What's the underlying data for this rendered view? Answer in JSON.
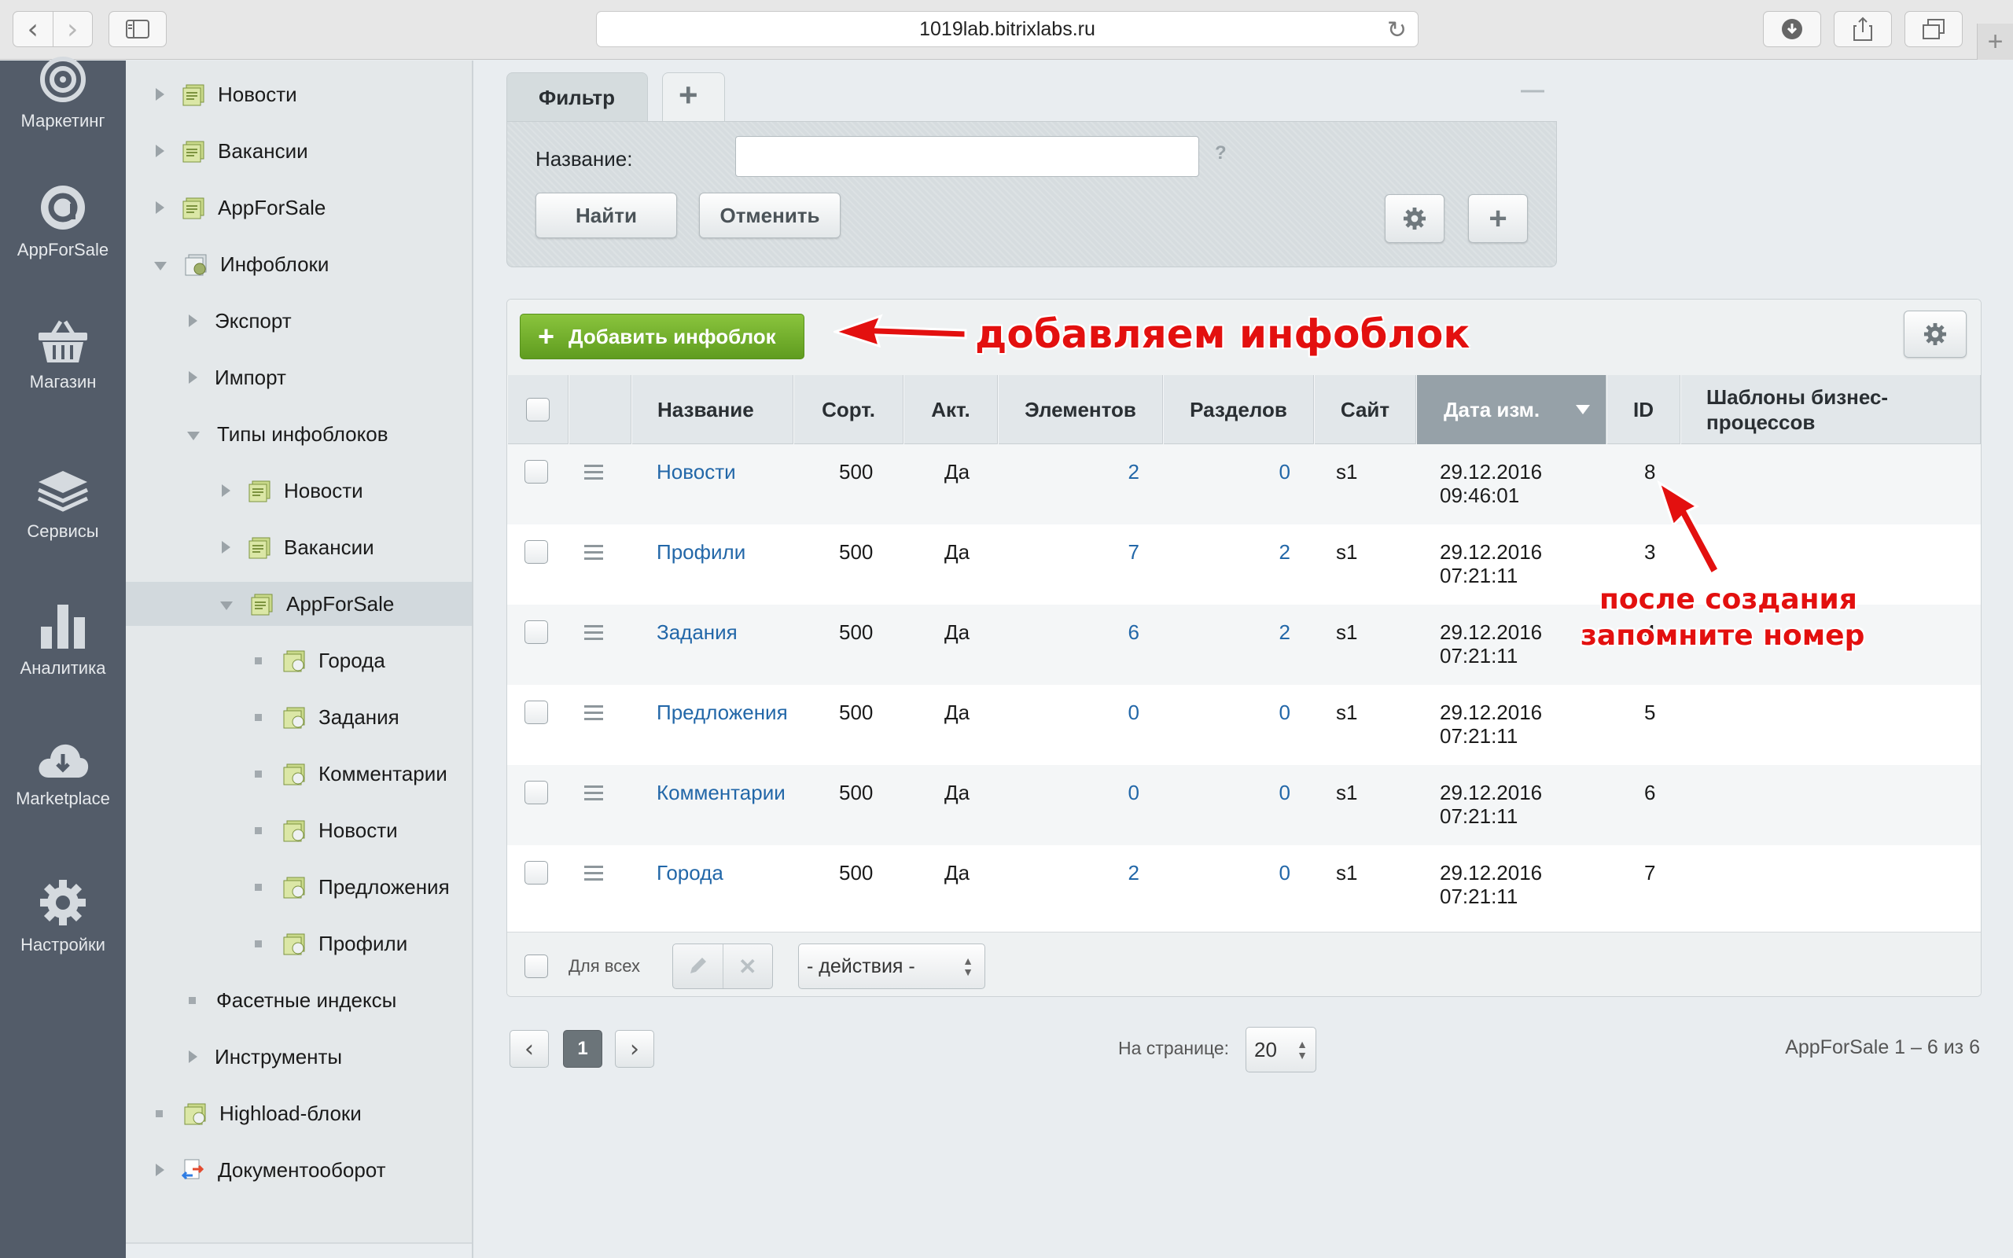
{
  "browser": {
    "url": "1019lab.bitrixlabs.ru",
    "back_glyph": "‹",
    "forward_glyph": "›",
    "newtab_glyph": "+"
  },
  "leftnav": {
    "items": [
      {
        "label": "Маркетинг",
        "icon": "target-icon"
      },
      {
        "label": "AppForSale",
        "icon": "appforsale-icon"
      },
      {
        "label": "Магазин",
        "icon": "basket-icon"
      },
      {
        "label": "Сервисы",
        "icon": "layers-icon"
      },
      {
        "label": "Аналитика",
        "icon": "bar-chart-icon"
      },
      {
        "label": "Marketplace",
        "icon": "cloud-download-icon"
      },
      {
        "label": "Настройки",
        "icon": "gear-icon"
      }
    ]
  },
  "tree": {
    "items": [
      {
        "label": "Новости"
      },
      {
        "label": "Вакансии"
      },
      {
        "label": "AppForSale"
      },
      {
        "label": "Инфоблоки"
      },
      {
        "label": "Экспорт"
      },
      {
        "label": "Импорт"
      },
      {
        "label": "Типы инфоблоков"
      },
      {
        "label": "Новости"
      },
      {
        "label": "Вакансии"
      },
      {
        "label": "AppForSale"
      },
      {
        "label": "Города"
      },
      {
        "label": "Задания"
      },
      {
        "label": "Комментарии"
      },
      {
        "label": "Новости"
      },
      {
        "label": "Предложения"
      },
      {
        "label": "Профили"
      },
      {
        "label": "Фасетные индексы"
      },
      {
        "label": "Инструменты"
      },
      {
        "label": "Highload-блоки"
      },
      {
        "label": "Документооборот"
      }
    ]
  },
  "filter": {
    "tab_label": "Фильтр",
    "add_tab_glyph": "+",
    "collapse_glyph": "—",
    "name_label": "Название:",
    "name_value": "",
    "help_glyph": "?",
    "find_label": "Найти",
    "cancel_label": "Отменить",
    "add_field_glyph": "+"
  },
  "grid": {
    "add_button_label": "Добавить инфоблок",
    "add_button_glyph": "+",
    "columns": [
      "Название",
      "Сорт.",
      "Акт.",
      "Элементов",
      "Разделов",
      "Сайт",
      "Дата изм.",
      "ID",
      "Шаблоны бизнес-процессов"
    ],
    "sorted_column": "Дата изм.",
    "rows": [
      {
        "name": "Новости",
        "sort": "500",
        "active": "Да",
        "elements": "2",
        "sections": "0",
        "site": "s1",
        "date": "29.12.2016",
        "time": "09:46:01",
        "id": "8"
      },
      {
        "name": "Профили",
        "sort": "500",
        "active": "Да",
        "elements": "7",
        "sections": "2",
        "site": "s1",
        "date": "29.12.2016",
        "time": "07:21:11",
        "id": "3"
      },
      {
        "name": "Задания",
        "sort": "500",
        "active": "Да",
        "elements": "6",
        "sections": "2",
        "site": "s1",
        "date": "29.12.2016",
        "time": "07:21:11",
        "id": "4"
      },
      {
        "name": "Предложения",
        "sort": "500",
        "active": "Да",
        "elements": "0",
        "sections": "0",
        "site": "s1",
        "date": "29.12.2016",
        "time": "07:21:11",
        "id": "5"
      },
      {
        "name": "Комментарии",
        "sort": "500",
        "active": "Да",
        "elements": "0",
        "sections": "0",
        "site": "s1",
        "date": "29.12.2016",
        "time": "07:21:11",
        "id": "6"
      },
      {
        "name": "Города",
        "sort": "500",
        "active": "Да",
        "elements": "2",
        "sections": "0",
        "site": "s1",
        "date": "29.12.2016",
        "time": "07:21:11",
        "id": "7"
      }
    ],
    "footer": {
      "for_all_label": "Для всех",
      "actions_value": "- действия -",
      "delete_glyph": "✕"
    }
  },
  "annotations": {
    "add_iblock": "добавляем инфоблок",
    "remember_line1": "после создания",
    "remember_line2": "запомните номер"
  },
  "pager": {
    "prev_glyph": "‹",
    "next_glyph": "›",
    "current_page": "1",
    "per_page_label": "На странице:",
    "per_page_value": "20",
    "summary": "AppForSale 1 – 6 из 6"
  },
  "colors": {
    "accent_link": "#2267a8",
    "add_button": "#6aa82a",
    "annotation": "#e3100f",
    "nav_bg": "#535c69"
  }
}
